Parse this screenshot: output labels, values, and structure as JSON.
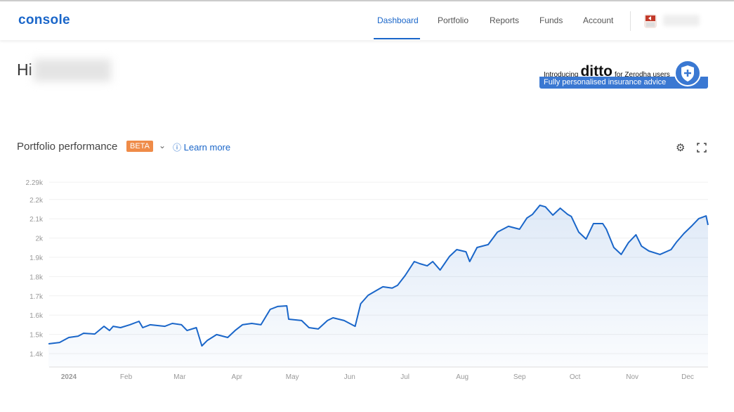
{
  "header": {
    "logo": "console",
    "nav": [
      {
        "label": "Dashboard",
        "active": true
      },
      {
        "label": "Portfolio"
      },
      {
        "label": "Reports"
      },
      {
        "label": "Funds"
      },
      {
        "label": "Account"
      }
    ]
  },
  "greeting": {
    "prefix": "Hi"
  },
  "promo": {
    "intro": "Introducing",
    "brand": "ditto",
    "suffix": "for Zerodha users",
    "tagline": "Fully personalised insurance advice"
  },
  "section": {
    "title": "Portfolio performance",
    "badge": "BETA",
    "learn_more": "Learn more",
    "icons": [
      "chevron-down-icon",
      "info-icon",
      "gear-icon",
      "fullscreen-icon"
    ]
  },
  "colors": {
    "accent": "#1a66c9",
    "badge": "#ef8b48",
    "line": "#1a66c9"
  },
  "chart_data": {
    "type": "area",
    "ylim": [
      1330,
      2290
    ],
    "y_ticks": [
      {
        "v": 1400,
        "label": "1.4k"
      },
      {
        "v": 1500,
        "label": "1.5k"
      },
      {
        "v": 1600,
        "label": "1.6k"
      },
      {
        "v": 1700,
        "label": "1.7k"
      },
      {
        "v": 1800,
        "label": "1.8k"
      },
      {
        "v": 1900,
        "label": "1.9k"
      },
      {
        "v": 2000,
        "label": "2k"
      },
      {
        "v": 2100,
        "label": "2.1k"
      },
      {
        "v": 2200,
        "label": "2.2k"
      },
      {
        "v": 2290,
        "label": "2.29k"
      }
    ],
    "x_ticks": [
      {
        "date": "2024-01-01",
        "label": "2024"
      },
      {
        "date": "2024-02-01",
        "label": "Feb"
      },
      {
        "date": "2024-03-01",
        "label": "Mar"
      },
      {
        "date": "2024-04-01",
        "label": "Apr"
      },
      {
        "date": "2024-05-01",
        "label": "May"
      },
      {
        "date": "2024-06-01",
        "label": "Jun"
      },
      {
        "date": "2024-07-01",
        "label": "Jul"
      },
      {
        "date": "2024-08-01",
        "label": "Aug"
      },
      {
        "date": "2024-09-01",
        "label": "Sep"
      },
      {
        "date": "2024-10-01",
        "label": "Oct"
      },
      {
        "date": "2024-11-01",
        "label": "Nov"
      },
      {
        "date": "2024-12-01",
        "label": "Dec"
      }
    ],
    "grid": true,
    "series": [
      {
        "points": [
          [
            "2023-12-21",
            1451
          ],
          [
            "2023-12-27",
            1458
          ],
          [
            "2024-01-01",
            1484
          ],
          [
            "2024-01-06",
            1491
          ],
          [
            "2024-01-09",
            1506
          ],
          [
            "2024-01-15",
            1502
          ],
          [
            "2024-01-20",
            1542
          ],
          [
            "2024-01-23",
            1520
          ],
          [
            "2024-01-25",
            1542
          ],
          [
            "2024-01-29",
            1535
          ],
          [
            "2024-02-03",
            1550
          ],
          [
            "2024-02-08",
            1568
          ],
          [
            "2024-02-10",
            1535
          ],
          [
            "2024-02-14",
            1550
          ],
          [
            "2024-02-22",
            1542
          ],
          [
            "2024-02-26",
            1557
          ],
          [
            "2024-03-02",
            1550
          ],
          [
            "2024-03-05",
            1520
          ],
          [
            "2024-03-10",
            1535
          ],
          [
            "2024-03-13",
            1440
          ],
          [
            "2024-03-16",
            1469
          ],
          [
            "2024-03-21",
            1499
          ],
          [
            "2024-03-27",
            1484
          ],
          [
            "2024-03-31",
            1520
          ],
          [
            "2024-04-04",
            1550
          ],
          [
            "2024-04-09",
            1557
          ],
          [
            "2024-04-14",
            1550
          ],
          [
            "2024-04-19",
            1630
          ],
          [
            "2024-04-23",
            1645
          ],
          [
            "2024-04-28",
            1648
          ],
          [
            "2024-04-29",
            1579
          ],
          [
            "2024-05-06",
            1572
          ],
          [
            "2024-05-10",
            1535
          ],
          [
            "2024-05-15",
            1528
          ],
          [
            "2024-05-20",
            1572
          ],
          [
            "2024-05-23",
            1586
          ],
          [
            "2024-05-29",
            1572
          ],
          [
            "2024-06-04",
            1542
          ],
          [
            "2024-06-07",
            1659
          ],
          [
            "2024-06-11",
            1703
          ],
          [
            "2024-06-15",
            1725
          ],
          [
            "2024-06-19",
            1747
          ],
          [
            "2024-06-24",
            1740
          ],
          [
            "2024-06-27",
            1755
          ],
          [
            "2024-07-01",
            1805
          ],
          [
            "2024-07-06",
            1878
          ],
          [
            "2024-07-09",
            1867
          ],
          [
            "2024-07-13",
            1856
          ],
          [
            "2024-07-16",
            1878
          ],
          [
            "2024-07-20",
            1834
          ],
          [
            "2024-07-25",
            1904
          ],
          [
            "2024-07-29",
            1940
          ],
          [
            "2024-08-03",
            1929
          ],
          [
            "2024-08-05",
            1878
          ],
          [
            "2024-08-09",
            1951
          ],
          [
            "2024-08-15",
            1966
          ],
          [
            "2024-08-20",
            2031
          ],
          [
            "2024-08-26",
            2061
          ],
          [
            "2024-09-01",
            2046
          ],
          [
            "2024-09-05",
            2104
          ],
          [
            "2024-09-08",
            2123
          ],
          [
            "2024-09-12",
            2170
          ],
          [
            "2024-09-15",
            2162
          ],
          [
            "2024-09-19",
            2119
          ],
          [
            "2024-09-23",
            2155
          ],
          [
            "2024-09-27",
            2123
          ],
          [
            "2024-09-29",
            2112
          ],
          [
            "2024-10-03",
            2031
          ],
          [
            "2024-10-07",
            1995
          ],
          [
            "2024-10-11",
            2075
          ],
          [
            "2024-10-16",
            2075
          ],
          [
            "2024-10-18",
            2046
          ],
          [
            "2024-10-22",
            1951
          ],
          [
            "2024-10-26",
            1915
          ],
          [
            "2024-10-30",
            1977
          ],
          [
            "2024-11-03",
            2017
          ],
          [
            "2024-11-06",
            1958
          ],
          [
            "2024-11-10",
            1933
          ],
          [
            "2024-11-16",
            1915
          ],
          [
            "2024-11-22",
            1940
          ],
          [
            "2024-11-25",
            1980
          ],
          [
            "2024-11-29",
            2024
          ],
          [
            "2024-12-03",
            2061
          ],
          [
            "2024-12-07",
            2101
          ],
          [
            "2024-12-11",
            2115
          ],
          [
            "2024-12-12",
            2068
          ]
        ]
      }
    ]
  }
}
